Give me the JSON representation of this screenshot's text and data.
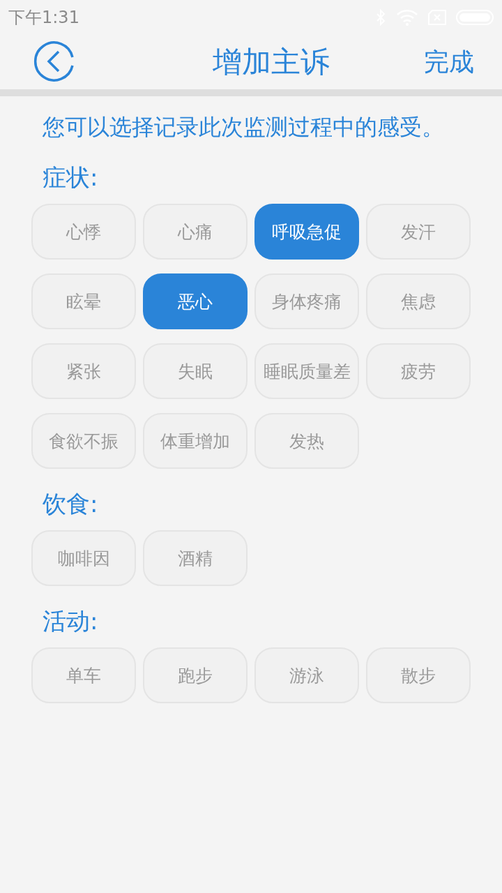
{
  "status_bar": {
    "time": "下午1:31"
  },
  "header": {
    "title": "增加主诉",
    "done": "完成"
  },
  "intro": "您可以选择记录此次监测过程中的感受。",
  "sections": [
    {
      "title": "症状:",
      "tags": [
        {
          "label": "心悸",
          "selected": false
        },
        {
          "label": "心痛",
          "selected": false
        },
        {
          "label": "呼吸急促",
          "selected": true
        },
        {
          "label": "发汗",
          "selected": false
        },
        {
          "label": "眩晕",
          "selected": false
        },
        {
          "label": "恶心",
          "selected": true
        },
        {
          "label": "身体疼痛",
          "selected": false
        },
        {
          "label": "焦虑",
          "selected": false
        },
        {
          "label": "紧张",
          "selected": false
        },
        {
          "label": "失眠",
          "selected": false
        },
        {
          "label": "睡眠质量差",
          "selected": false
        },
        {
          "label": "疲劳",
          "selected": false
        },
        {
          "label": "食欲不振",
          "selected": false
        },
        {
          "label": "体重增加",
          "selected": false
        },
        {
          "label": "发热",
          "selected": false
        }
      ]
    },
    {
      "title": "饮食:",
      "tags": [
        {
          "label": "咖啡因",
          "selected": false
        },
        {
          "label": "酒精",
          "selected": false
        }
      ]
    },
    {
      "title": "活动:",
      "tags": [
        {
          "label": "单车",
          "selected": false
        },
        {
          "label": "跑步",
          "selected": false
        },
        {
          "label": "游泳",
          "selected": false
        },
        {
          "label": "散步",
          "selected": false
        }
      ]
    }
  ]
}
